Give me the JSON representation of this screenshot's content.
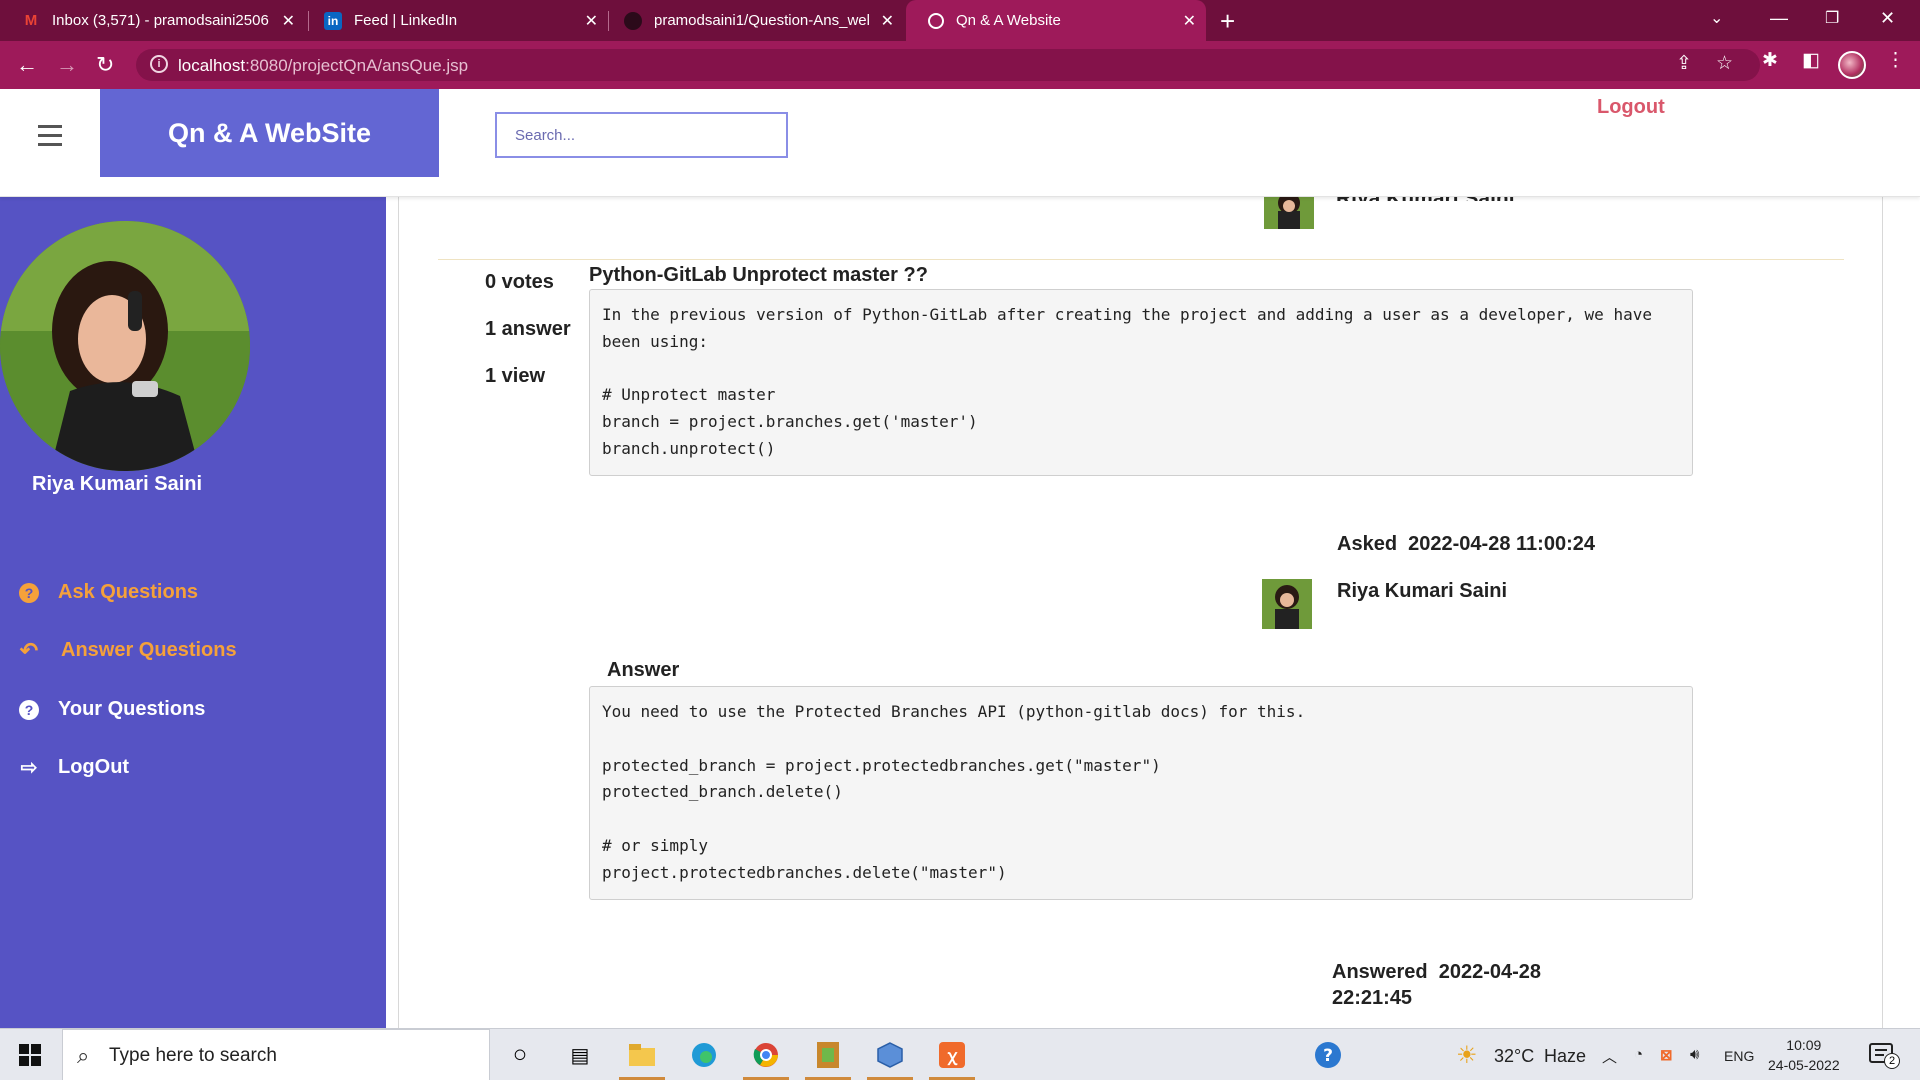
{
  "browser": {
    "tabs": [
      {
        "icon": "gmail-icon",
        "title": "Inbox (3,571) - pramodsaini2506",
        "active": false
      },
      {
        "icon": "linkedin-icon",
        "title": "Feed | LinkedIn",
        "active": false
      },
      {
        "icon": "github-icon",
        "title": "pramodsaini1/Question-Ans_wel",
        "active": false
      },
      {
        "icon": "globe-icon",
        "title": "Qn & A Website",
        "active": true
      }
    ],
    "url_host": "localhost",
    "url_path": ":8080/projectQnA/ansQue.jsp"
  },
  "app": {
    "brand": "Qn & A WebSite",
    "search_placeholder": "Search...",
    "logout_label": "Logout"
  },
  "sidebar": {
    "user_name": "Riya Kumari Saini",
    "items": [
      {
        "label": "Ask Questions",
        "icon": "question-circle-icon",
        "color": "#f5a13a"
      },
      {
        "label": "Answer Questions",
        "icon": "reply-icon",
        "color": "#f5a13a"
      },
      {
        "label": "Your Questions",
        "icon": "question-circle-icon",
        "color": "#ffffff"
      },
      {
        "label": "LogOut",
        "icon": "sign-out-icon",
        "color": "#ffffff"
      }
    ]
  },
  "previous_post": {
    "author": "Riya Kumari Saini"
  },
  "question": {
    "votes": "0 votes",
    "answers": "1 answer",
    "views": "1 view",
    "title": "Python-GitLab Unprotect master ??",
    "body": "In the previous version of Python-GitLab after creating the project and adding a user as a developer, we have been using:\n\n# Unprotect master\nbranch = project.branches.get('master')\nbranch.unprotect()",
    "asked_label": "Asked",
    "asked_at": "2022-04-28 11:00:24",
    "author": "Riya Kumari Saini"
  },
  "answer": {
    "heading": "Answer",
    "body": "You need to use the Protected Branches API (python-gitlab docs) for this.\n\nprotected_branch = project.protectedbranches.get(\"master\")\nprotected_branch.delete()\n\n# or simply\nproject.protectedbranches.delete(\"master\")",
    "answered_label": "Answered",
    "answered_date": "2022-04-28",
    "answered_time": "22:21:45"
  },
  "taskbar": {
    "search_placeholder": "Type here to search",
    "weather_temp": "32°C",
    "weather_desc": "Haze",
    "language": "ENG",
    "time": "10:09",
    "date": "24-05-2022",
    "notification_count": "2"
  }
}
